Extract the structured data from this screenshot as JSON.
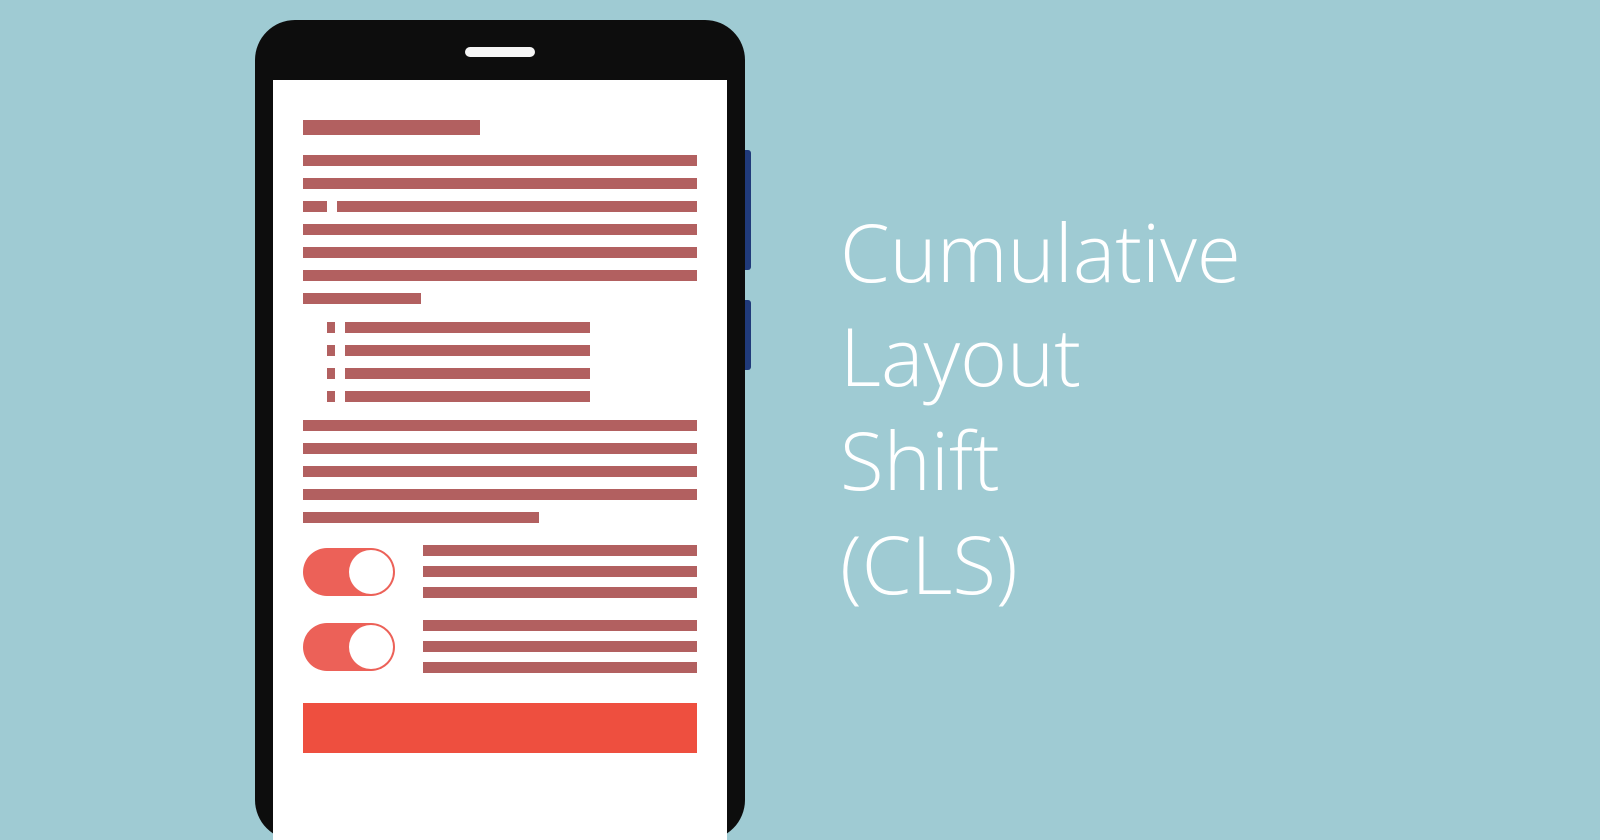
{
  "heading": {
    "line1": "Cumulative",
    "line2": "Layout",
    "line3": "Shift",
    "line4": "(CLS)"
  },
  "colors": {
    "background": "#9fcbd3",
    "phone_body": "#0d0d0d",
    "text_line": "#b26060",
    "toggle_on": "#ec6158",
    "button": "#ee4f3f",
    "side_button": "#203a7a",
    "heading_text": "#ffffff"
  },
  "phone": {
    "toggles": [
      {
        "state": "on"
      },
      {
        "state": "on"
      }
    ]
  }
}
